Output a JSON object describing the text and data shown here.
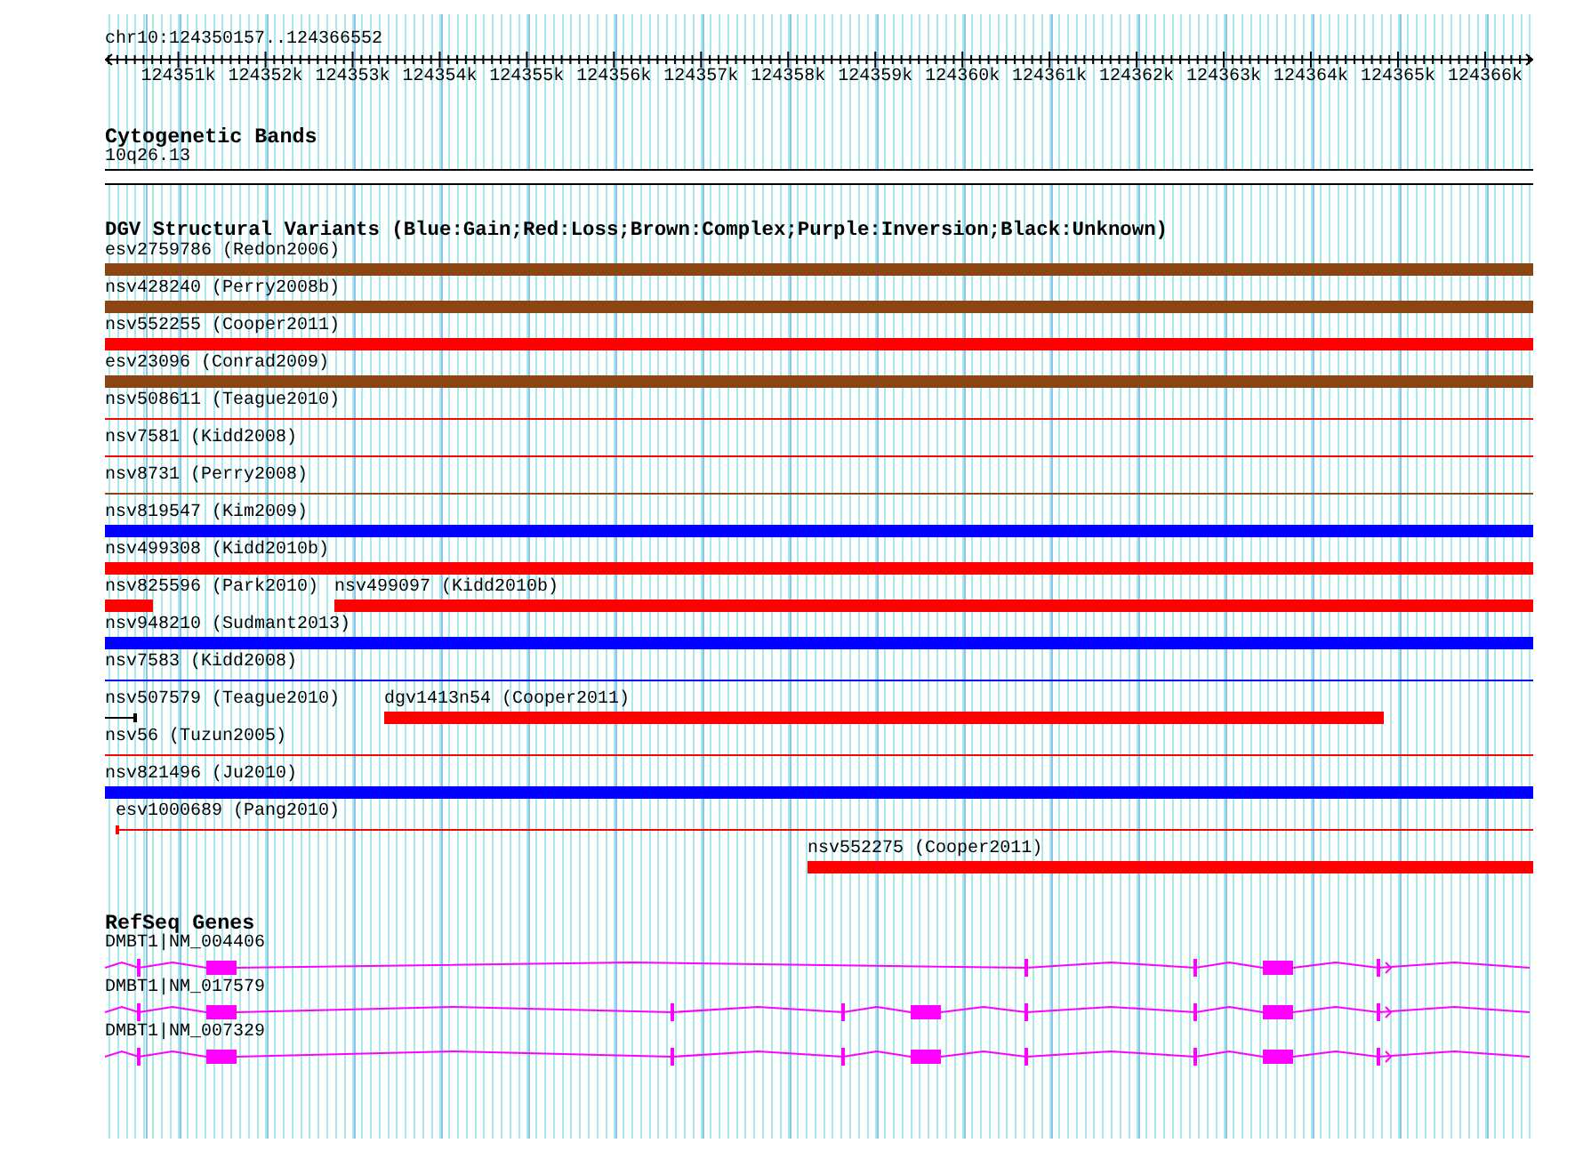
{
  "ruler": {
    "title": "chr10:124350157..124366552",
    "ticks": [
      {
        "label": "124351k"
      },
      {
        "label": "124352k"
      },
      {
        "label": "124353k"
      },
      {
        "label": "124354k"
      },
      {
        "label": "124355k"
      },
      {
        "label": "124356k"
      },
      {
        "label": "124357k"
      },
      {
        "label": "124358k"
      },
      {
        "label": "124359k"
      },
      {
        "label": "124360k"
      },
      {
        "label": "124361k"
      },
      {
        "label": "124362k"
      },
      {
        "label": "124363k"
      },
      {
        "label": "124364k"
      },
      {
        "label": "124365k"
      },
      {
        "label": "124366k"
      }
    ]
  },
  "cytogenetic_bands": {
    "title": "Cytogenetic Bands",
    "band": "10q26.13"
  },
  "dgv": {
    "title": "DGV Structural Variants (Blue:Gain;Red:Loss;Brown:Complex;Purple:Inversion;Black:Unknown)",
    "rows": [
      {
        "features": [
          {
            "name": "esv2759786 (Redon2006)",
            "color": "#8b4513",
            "kind": "thick"
          }
        ]
      },
      {
        "features": [
          {
            "name": "nsv428240 (Perry2008b)",
            "color": "#8b4513",
            "kind": "thick"
          }
        ]
      },
      {
        "features": [
          {
            "name": "nsv552255 (Cooper2011)",
            "color": "#ff0000",
            "kind": "thick"
          }
        ]
      },
      {
        "features": [
          {
            "name": "esv23096 (Conrad2009)",
            "color": "#8b4513",
            "kind": "thick"
          }
        ]
      },
      {
        "features": [
          {
            "name": "nsv508611 (Teague2010)",
            "color": "#ff0000",
            "kind": "thin"
          }
        ]
      },
      {
        "features": [
          {
            "name": "nsv7581 (Kidd2008)",
            "color": "#ff0000",
            "kind": "thin"
          }
        ]
      },
      {
        "features": [
          {
            "name": "nsv8731 (Perry2008)",
            "color": "#8b4513",
            "kind": "thin"
          }
        ]
      },
      {
        "features": [
          {
            "name": "nsv819547 (Kim2009)",
            "color": "#0000ff",
            "kind": "thick"
          }
        ]
      },
      {
        "features": [
          {
            "name": "nsv499308 (Kidd2010b)",
            "color": "#ff0000",
            "kind": "thick"
          }
        ]
      },
      {
        "features": [
          {
            "name": "nsv825596 (Park2010)",
            "color": "#ff0000",
            "kind": "thick"
          },
          {
            "name": "nsv499097 (Kidd2010b)",
            "color": "#ff0000",
            "kind": "thick"
          }
        ]
      },
      {
        "features": [
          {
            "name": "nsv948210 (Sudmant2013)",
            "color": "#0000ff",
            "kind": "thick"
          }
        ]
      },
      {
        "features": [
          {
            "name": "nsv7583 (Kidd2008)",
            "color": "#0000ff",
            "kind": "thin"
          }
        ]
      },
      {
        "features": [
          {
            "name": "nsv507579 (Teague2010)",
            "color": "#000000",
            "kind": "thin"
          },
          {
            "name": "dgv1413n54 (Cooper2011)",
            "color": "#ff0000",
            "kind": "thick"
          }
        ]
      },
      {
        "features": [
          {
            "name": "nsv56 (Tuzun2005)",
            "color": "#ff0000",
            "kind": "thin"
          }
        ]
      },
      {
        "features": [
          {
            "name": "nsv821496 (Ju2010)",
            "color": "#0000ff",
            "kind": "thick"
          }
        ]
      },
      {
        "features": [
          {
            "name": "esv1000689 (Pang2010)",
            "color": "#ff0000",
            "kind": "thin"
          }
        ]
      },
      {
        "features": [
          {
            "name": "nsv552275 (Cooper2011)",
            "color": "#ff0000",
            "kind": "thick"
          }
        ]
      }
    ]
  },
  "refseq": {
    "title": "RefSeq Genes",
    "transcripts": [
      {
        "name": "DMBT1|NM_004406"
      },
      {
        "name": "DMBT1|NM_017579"
      },
      {
        "name": "DMBT1|NM_007329"
      }
    ]
  }
}
